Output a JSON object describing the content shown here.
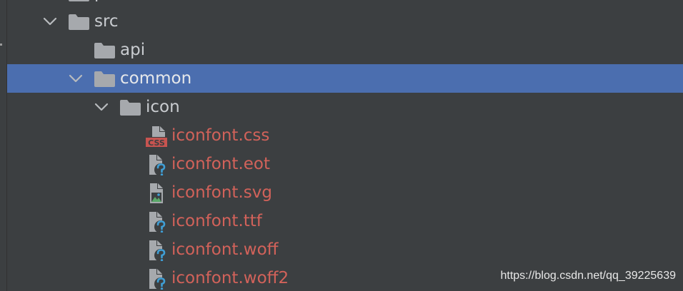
{
  "tree": {
    "partial_top_label": "p",
    "rows": [
      {
        "label": "src"
      },
      {
        "label": "api"
      },
      {
        "label": "common"
      },
      {
        "label": "icon"
      },
      {
        "label": "iconfont.css"
      },
      {
        "label": "iconfont.eot"
      },
      {
        "label": "iconfont.svg"
      },
      {
        "label": "iconfont.ttf"
      },
      {
        "label": "iconfont.woff"
      },
      {
        "label": "iconfont.woff2"
      }
    ]
  },
  "icons": {
    "expanded": "chevron-down-icon",
    "folder": "folder-icon",
    "css_file": "css-file-icon",
    "unknown_file": "unknown-file-icon",
    "image_file": "image-file-icon"
  },
  "colors": {
    "background": "#3c3f41",
    "selection": "#4b6eaf",
    "text": "#c9ccd0",
    "untracked_file_text": "#d2625a"
  },
  "watermark": "https://blog.csdn.net/qq_39225639"
}
